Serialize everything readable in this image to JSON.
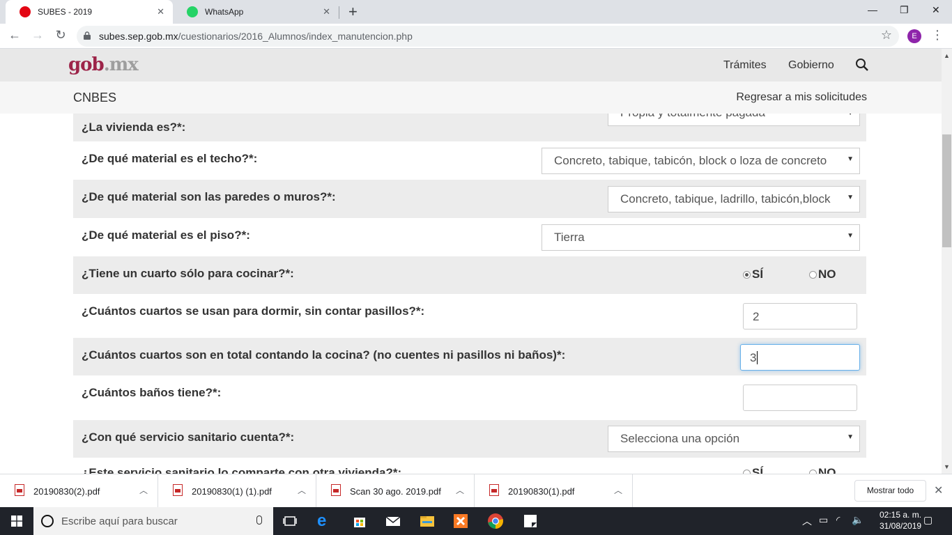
{
  "browser": {
    "tabs": [
      {
        "title": "SUBES - 2019",
        "active": true
      },
      {
        "title": "WhatsApp",
        "active": false
      }
    ],
    "url_domain": "subes.sep.gob.mx",
    "url_path": "/cuestionarios/2016_Alumnos/index_manutencion.php",
    "profile_initial": "E"
  },
  "header": {
    "logo_main": "gob",
    "logo_suffix": ".mx",
    "nav": [
      "Trámites",
      "Gobierno"
    ],
    "site_name": "CNBES",
    "back_link": "Regresar a mis solicitudes"
  },
  "form": {
    "vivienda": {
      "label": "¿La vivienda es?*:",
      "value": "Propia y totalmente pagada"
    },
    "techo": {
      "label": "¿De qué material es el techo?*:",
      "value": "Concreto, tabique, tabicón, block o loza de concreto"
    },
    "paredes": {
      "label": "¿De qué material son las paredes o muros?*:",
      "value": "Concreto, tabique, ladrillo, tabicón,block"
    },
    "piso": {
      "label": "¿De qué material es el piso?*:",
      "value": "Tierra"
    },
    "cocina": {
      "label": "¿Tiene un cuarto sólo para cocinar?*:",
      "yes": "SÍ",
      "no": "NO",
      "selected": "SÍ"
    },
    "dormir": {
      "label": "¿Cuántos cuartos se usan para dormir, sin contar pasillos?*:",
      "value": "2"
    },
    "total": {
      "label": "¿Cuántos cuartos son en total contando la cocina? (no cuentes ni pasillos ni baños)*:",
      "value": "3"
    },
    "banos": {
      "label": "¿Cuántos baños tiene?*:",
      "value": ""
    },
    "sanitario": {
      "label": "¿Con qué servicio sanitario cuenta?*:",
      "value": "Selecciona una opción"
    },
    "partial": {
      "label": "¿Este servicio sanitario lo comparte con otra vivienda?*:",
      "yes": "SÍ",
      "no": "NO"
    }
  },
  "downloads": {
    "files": [
      "20190830(2).pdf",
      "20190830(1) (1).pdf",
      "Scan 30 ago. 2019.pdf",
      "20190830(1).pdf"
    ],
    "show_all": "Mostrar todo"
  },
  "taskbar": {
    "search_placeholder": "Escribe aquí para buscar",
    "time": "02:15 a. m.",
    "date": "31/08/2019"
  },
  "colors": {
    "brand": "#9d2449",
    "taskbar": "#20232a"
  }
}
